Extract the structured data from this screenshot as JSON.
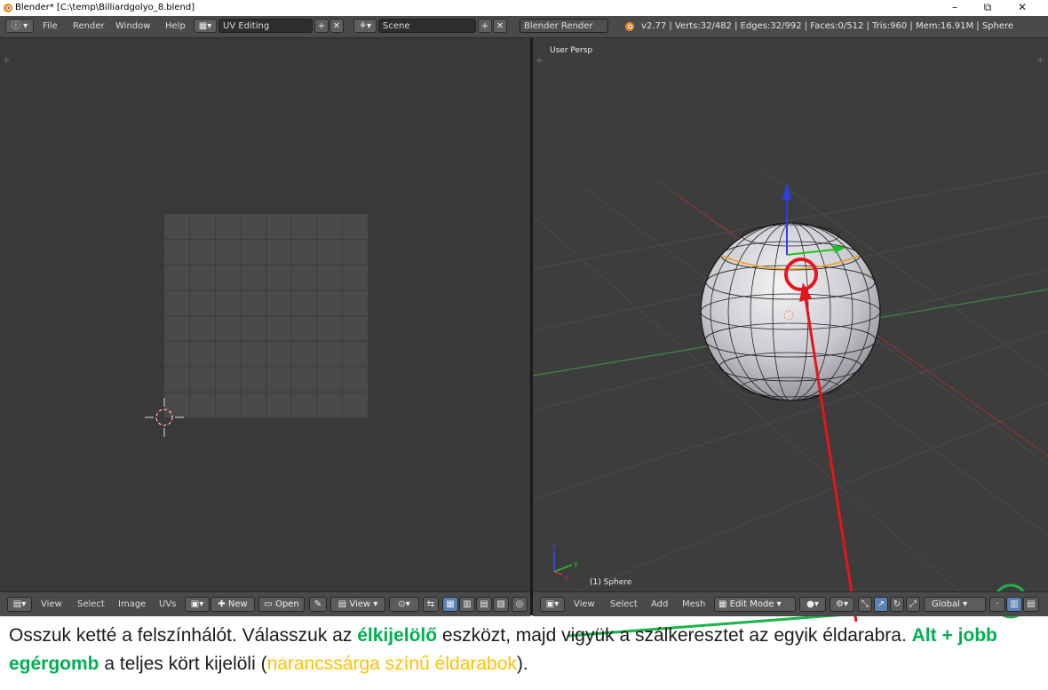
{
  "window": {
    "title": "Blender* [C:\\temp\\Billiardgolyo_8.blend]",
    "controls": [
      "–",
      "⧉",
      "✕"
    ]
  },
  "info_header": {
    "menus": [
      "File",
      "Render",
      "Window",
      "Help"
    ],
    "screen_layout": "UV Editing",
    "scene": "Scene",
    "render_engine": "Blender Render",
    "stats": "v2.77 | Verts:32/482 | Edges:32/992 | Faces:0/512 | Tris:960 | Mem:16.91M | Sphere"
  },
  "uv_editor": {
    "menus": [
      "View",
      "Select",
      "Image",
      "UVs"
    ],
    "new_label": "New",
    "open_label": "Open",
    "view_label": "View"
  },
  "viewport": {
    "view_label": "User Persp",
    "object_label": "(1) Sphere",
    "menus": [
      "View",
      "Select",
      "Add",
      "Mesh"
    ],
    "mode": "Edit Mode",
    "orientation": "Global",
    "axes": {
      "x": "x",
      "y": "y",
      "z": "z"
    }
  },
  "caption": {
    "p1": "Osszuk ketté a felszínhálót. Válasszuk az ",
    "h1": "élkijelölő",
    "p2": " eszközt, majd vigyük a szálkeresztet az egyik éldarabra. ",
    "h2": "Alt + jobb egérgomb",
    "p3": " a teljes kört kijelöli (",
    "h3": "narancssárga színű éldarabok",
    "p4": ")."
  },
  "colors": {
    "annotation_red": "#e8141c",
    "annotation_green": "#1db34a",
    "selected_edges": "#f0a020"
  }
}
